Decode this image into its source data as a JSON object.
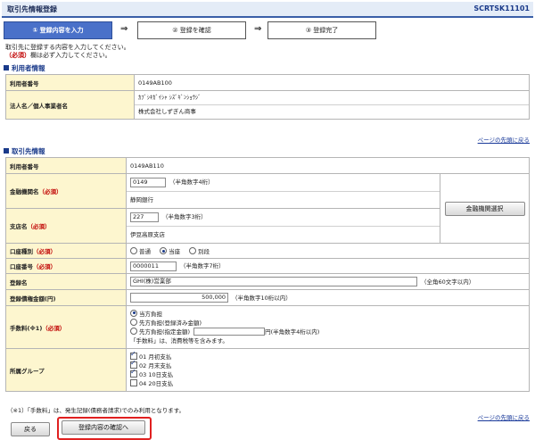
{
  "header": {
    "title": "取引先情報登録",
    "screen_id": "SCRTSK11101"
  },
  "steps": [
    {
      "label": "① 登録内容を入力"
    },
    {
      "label": "② 登録を確認"
    },
    {
      "label": "③ 登録完了"
    }
  ],
  "step_arrow": "⇒",
  "intro": {
    "line1": "取引先に登録する内容を入力してください。",
    "req_tag": "（必須）",
    "line2_rest": "欄は必ず入力してください。"
  },
  "user_section": {
    "title": "利用者情報",
    "user_no_label": "利用者番号",
    "user_no": "0149AB100",
    "corp_label": "法人名／個人事業者名",
    "corp_kana": "ｶﾌﾞｼｷｶﾞｲｼｬ ｼｽﾞｷﾞﾝｼｮｳｼﾞ",
    "corp_name": "株式会社しずぎん商事"
  },
  "page_top_link": "ページの先頭に戻る",
  "partner_section": {
    "title": "取引先情報",
    "user_no_label": "利用者番号",
    "user_no": "0149AB110",
    "bank_label": "金融機関名",
    "bank_code": "0149",
    "bank_code_hint": "（半角数字4桁）",
    "bank_name": "静岡銀行",
    "bank_select_button": "金融機関選択",
    "branch_label": "支店名",
    "branch_code": "227",
    "branch_code_hint": "（半角数字3桁）",
    "branch_name": "伊豆高原支店",
    "req_tag": "（必須）",
    "acct_type_label": "口座種別",
    "acct_types": [
      "普通",
      "当座",
      "別段"
    ],
    "acct_type_selected": "当座",
    "acct_no_label": "口座番号",
    "acct_no": "0000011",
    "acct_no_hint": "（半角数字7桁）",
    "reg_name_label": "登録名",
    "reg_name": "GHI(株)営業部",
    "reg_name_hint": "（全角60文字以内）",
    "amount_label": "登録債権金額(円)",
    "amount": "500,000",
    "amount_hint": "（半角数字10桁以内）",
    "fee_label": "手数料(※1)",
    "fee_options": [
      "当方負担",
      "先方負担(登録済み金額)",
      "先方負担(指定金額)"
    ],
    "fee_selected": "当方負担",
    "fee_amount_unit": "円(半角数字4桁以内)",
    "fee_note": "「手数料」は、消費税等を含みます。",
    "group_label": "所属グループ",
    "groups": [
      {
        "label": "01 月初支払",
        "checked": true
      },
      {
        "label": "02 月末支払",
        "checked": true
      },
      {
        "label": "03 10日支払",
        "checked": true
      },
      {
        "label": "04 20日支払",
        "checked": false
      }
    ]
  },
  "footnote": "（※1）「手数料」は、発生記録(債務者請求)でのみ利用となります。",
  "buttons": {
    "back": "戻る",
    "confirm": "登録内容の確認へ"
  }
}
